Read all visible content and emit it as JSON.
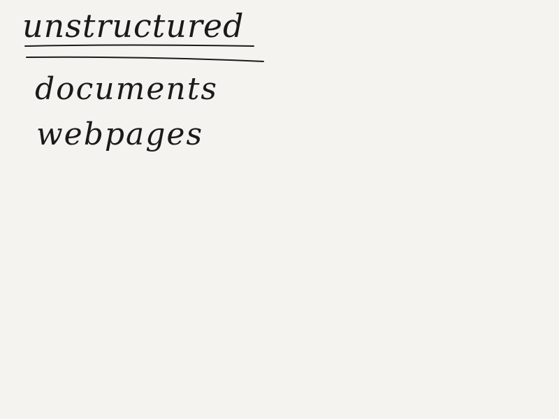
{
  "note": {
    "heading": "unstructured",
    "items": [
      "documents",
      "webpages"
    ]
  },
  "colors": {
    "paper": "#f4f3ef",
    "ink": "#1a1a1a"
  }
}
